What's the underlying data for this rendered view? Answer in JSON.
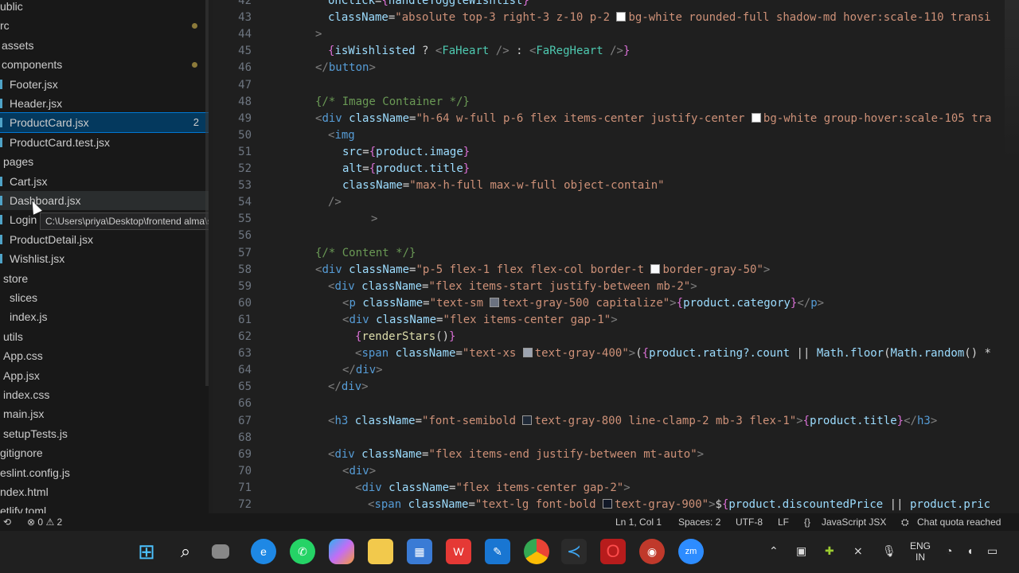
{
  "explorer": {
    "items": [
      {
        "label": "ublic",
        "indent": 0
      },
      {
        "label": "rc",
        "indent": 0,
        "dot": true
      },
      {
        "label": "assets",
        "indent": 2
      },
      {
        "label": "components",
        "indent": 2,
        "dot": true
      },
      {
        "label": "Footer.jsx",
        "indent": 12,
        "jsx": true
      },
      {
        "label": "Header.jsx",
        "indent": 12,
        "jsx": true
      },
      {
        "label": "ProductCard.jsx",
        "indent": 12,
        "jsx": true,
        "selected": true,
        "badge": "2"
      },
      {
        "label": "ProductCard.test.jsx",
        "indent": 12,
        "jsx": true
      },
      {
        "label": "pages",
        "indent": 4
      },
      {
        "label": "Cart.jsx",
        "indent": 12,
        "jsx": true
      },
      {
        "label": "Dashboard.jsx",
        "indent": 12,
        "jsx": true,
        "hover": true
      },
      {
        "label": "Login",
        "indent": 12,
        "jsx": true
      },
      {
        "label": "ProductDetail.jsx",
        "indent": 12,
        "jsx": true
      },
      {
        "label": "Wishlist.jsx",
        "indent": 12,
        "jsx": true
      },
      {
        "label": "store",
        "indent": 4
      },
      {
        "label": "slices",
        "indent": 12
      },
      {
        "label": "index.js",
        "indent": 12
      },
      {
        "label": "utils",
        "indent": 4
      },
      {
        "label": "App.css",
        "indent": 4
      },
      {
        "label": "App.jsx",
        "indent": 4
      },
      {
        "label": "index.css",
        "indent": 4
      },
      {
        "label": "main.jsx",
        "indent": 4
      },
      {
        "label": "setupTests.js",
        "indent": 4
      },
      {
        "label": "gitignore",
        "indent": 0
      },
      {
        "label": "eslint.config.js",
        "indent": 0
      },
      {
        "label": "ndex.html",
        "indent": 0
      },
      {
        "label": "etlify.toml",
        "indent": 0
      }
    ],
    "tooltip": "C:\\Users\\priya\\Desktop\\frontend alma\\src\\pages\\Dashboard.jsx"
  },
  "editor": {
    "lines": [
      {
        "n": "42",
        "code": "<span class='at'>onClick</span><span class='pl'>=</span><span class='br'>{</span><span class='kw'>handleToggleWishlist</span><span class='br'>}</span>",
        "indent": 116
      },
      {
        "n": "43",
        "code": "<span class='at'>className</span><span class='pl'>=</span><span class='st'>\"absolute top-3 right-3 z-10 p-2 <span class='sw' style='background:#fff'></span>bg-white rounded-full shadow-md hover:scale-110 transi</span>",
        "indent": 116
      },
      {
        "n": "44",
        "code": "<span class='tg'>&gt;</span>",
        "indent": 100
      },
      {
        "n": "45",
        "code": "<span class='br'>{</span><span class='kw'>isWishlisted</span><span class='pl'> ? </span><span class='tg'>&lt;</span><span class='tn' style='color:#4ec9b0'>FaHeart</span><span class='tg'> /&gt;</span><span class='pl'> : </span><span class='tg'>&lt;</span><span class='tn' style='color:#4ec9b0'>FaRegHeart</span><span class='tg'> /&gt;</span><span class='br'>}</span>",
        "indent": 116
      },
      {
        "n": "46",
        "code": "<span class='tg'>&lt;/</span><span class='tn'>button</span><span class='tg'>&gt;</span>",
        "indent": 100
      },
      {
        "n": "47",
        "code": "",
        "indent": 100
      },
      {
        "n": "48",
        "code": "<span class='cm'>{/* Image Container */}</span>",
        "indent": 100
      },
      {
        "n": "49",
        "code": "<span class='tg'>&lt;</span><span class='tn'>div</span> <span class='at'>className</span><span class='pl'>=</span><span class='st'>\"h-64 w-full p-6 flex items-center justify-center <span class='sw' style='background:#fff'></span>bg-white group-hover:scale-105 tra</span>",
        "indent": 100
      },
      {
        "n": "50",
        "code": "<span class='tg'>&lt;</span><span class='tn'>img</span>",
        "indent": 116
      },
      {
        "n": "51",
        "code": "<span class='at'>src</span><span class='pl'>=</span><span class='br'>{</span><span class='kw'>product.image</span><span class='br'>}</span>",
        "indent": 134
      },
      {
        "n": "52",
        "code": "<span class='at'>alt</span><span class='pl'>=</span><span class='br'>{</span><span class='kw'>product.title</span><span class='br'>}</span>",
        "indent": 134
      },
      {
        "n": "53",
        "code": "<span class='at'>className</span><span class='pl'>=</span><span class='st'>\"max-h-full max-w-full object-contain\"</span>",
        "indent": 134
      },
      {
        "n": "54",
        "code": "<span class='tg'>/&gt;</span>",
        "indent": 116
      },
      {
        "n": "55",
        "code": "<span class='tg'>&gt;</span>",
        "indent": 170
      },
      {
        "n": "56",
        "code": "",
        "indent": 100
      },
      {
        "n": "57",
        "code": "<span class='cm'>{/* Content */}</span>",
        "indent": 100
      },
      {
        "n": "58",
        "code": "<span class='tg'>&lt;</span><span class='tn'>div</span> <span class='at'>className</span><span class='pl'>=</span><span class='st'>\"p-5 flex-1 flex flex-col border-t <span class='sw' style='background:#f9fafb'></span>border-gray-50\"</span><span class='tg'>&gt;</span>",
        "indent": 100
      },
      {
        "n": "59",
        "code": "<span class='tg'>&lt;</span><span class='tn'>div</span> <span class='at'>className</span><span class='pl'>=</span><span class='st'>\"flex items-start justify-between mb-2\"</span><span class='tg'>&gt;</span>",
        "indent": 116
      },
      {
        "n": "60",
        "code": "<span class='tg'>&lt;</span><span class='tn'>p</span> <span class='at'>className</span><span class='pl'>=</span><span class='st'>\"text-sm <span class='sw' style='background:#6b7280'></span>text-gray-500 capitalize\"</span><span class='tg'>&gt;</span><span class='br'>{</span><span class='kw'>product.category</span><span class='br'>}</span><span class='tg'>&lt;/</span><span class='tn'>p</span><span class='tg'>&gt;</span>",
        "indent": 134
      },
      {
        "n": "61",
        "code": "<span class='tg'>&lt;</span><span class='tn'>div</span> <span class='at'>className</span><span class='pl'>=</span><span class='st'>\"flex items-center gap-1\"</span><span class='tg'>&gt;</span>",
        "indent": 134
      },
      {
        "n": "62",
        "code": "<span class='br'>{</span><span class='yl' style='color:#dcdcaa'>renderStars</span><span class='pl'>()</span><span class='br'>}</span>",
        "indent": 150
      },
      {
        "n": "63",
        "code": "<span class='tg'>&lt;</span><span class='tn'>span</span> <span class='at'>className</span><span class='pl'>=</span><span class='st'>\"text-xs <span class='sw' style='background:#9ca3af'></span>text-gray-400\"</span><span class='tg'>&gt;</span><span class='pl'>(</span><span class='br'>{</span><span class='kw'>product.rating?.count</span><span class='pl'> || </span><span class='kw'>Math.floor</span><span class='pl'>(</span><span class='kw'>Math.random</span><span class='pl'>() *</span>",
        "indent": 150
      },
      {
        "n": "64",
        "code": "<span class='tg'>&lt;/</span><span class='tn'>div</span><span class='tg'>&gt;</span>",
        "indent": 134
      },
      {
        "n": "65",
        "code": "<span class='tg'>&lt;/</span><span class='tn'>div</span><span class='tg'>&gt;</span>",
        "indent": 116
      },
      {
        "n": "66",
        "code": "",
        "indent": 100
      },
      {
        "n": "67",
        "code": "<span class='tg'>&lt;</span><span class='tn'>h3</span> <span class='at'>className</span><span class='pl'>=</span><span class='st'>\"font-semibold <span class='sw' style='background:#1f2937'></span>text-gray-800 line-clamp-2 mb-3 flex-1\"</span><span class='tg'>&gt;</span><span class='br'>{</span><span class='kw'>product.title</span><span class='br'>}</span><span class='tg'>&lt;/</span><span class='tn'>h3</span><span class='tg'>&gt;</span>",
        "indent": 116
      },
      {
        "n": "68",
        "code": "",
        "indent": 100
      },
      {
        "n": "69",
        "code": "<span class='tg'>&lt;</span><span class='tn'>div</span> <span class='at'>className</span><span class='pl'>=</span><span class='st'>\"flex items-end justify-between mt-auto\"</span><span class='tg'>&gt;</span>",
        "indent": 116
      },
      {
        "n": "70",
        "code": "<span class='tg'>&lt;</span><span class='tn'>div</span><span class='tg'>&gt;</span>",
        "indent": 134
      },
      {
        "n": "71",
        "code": "<span class='tg'>&lt;</span><span class='tn'>div</span> <span class='at'>className</span><span class='pl'>=</span><span class='st'>\"flex items-center gap-2\"</span><span class='tg'>&gt;</span>",
        "indent": 150
      },
      {
        "n": "72",
        "code": "<span class='tg'>&lt;</span><span class='tn'>span</span> <span class='at'>className</span><span class='pl'>=</span><span class='st'>\"text-lg font-bold <span class='sw' style='background:#111827'></span>text-gray-900\"</span><span class='tg'>&gt;</span><span class='pl'>$</span><span class='br'>{</span><span class='kw'>product.discountedPrice</span><span class='pl'> || </span><span class='kw'>product.pric</span>",
        "indent": 166
      }
    ]
  },
  "statusbar": {
    "errors": "0",
    "warnings": "2",
    "position": "Ln 1, Col 1",
    "spaces": "Spaces: 2",
    "encoding": "UTF-8",
    "eol": "LF",
    "language": "JavaScript JSX",
    "chat_quota": "Chat quota reached"
  },
  "taskbar": {
    "lang": "ENG",
    "region": "IN",
    "icons": [
      "windows-start-icon",
      "search-icon",
      "files-icon",
      "edge-icon",
      "whatsapp-icon",
      "copilot-icon",
      "file-explorer-icon",
      "store-icon",
      "wps-icon",
      "word-icon",
      "chrome-icon",
      "vscode-icon",
      "opera-icon",
      "screen-recorder-icon",
      "zoom-icon"
    ]
  },
  "colors": {
    "accent": "#0078d4",
    "selection": "#04395e"
  }
}
